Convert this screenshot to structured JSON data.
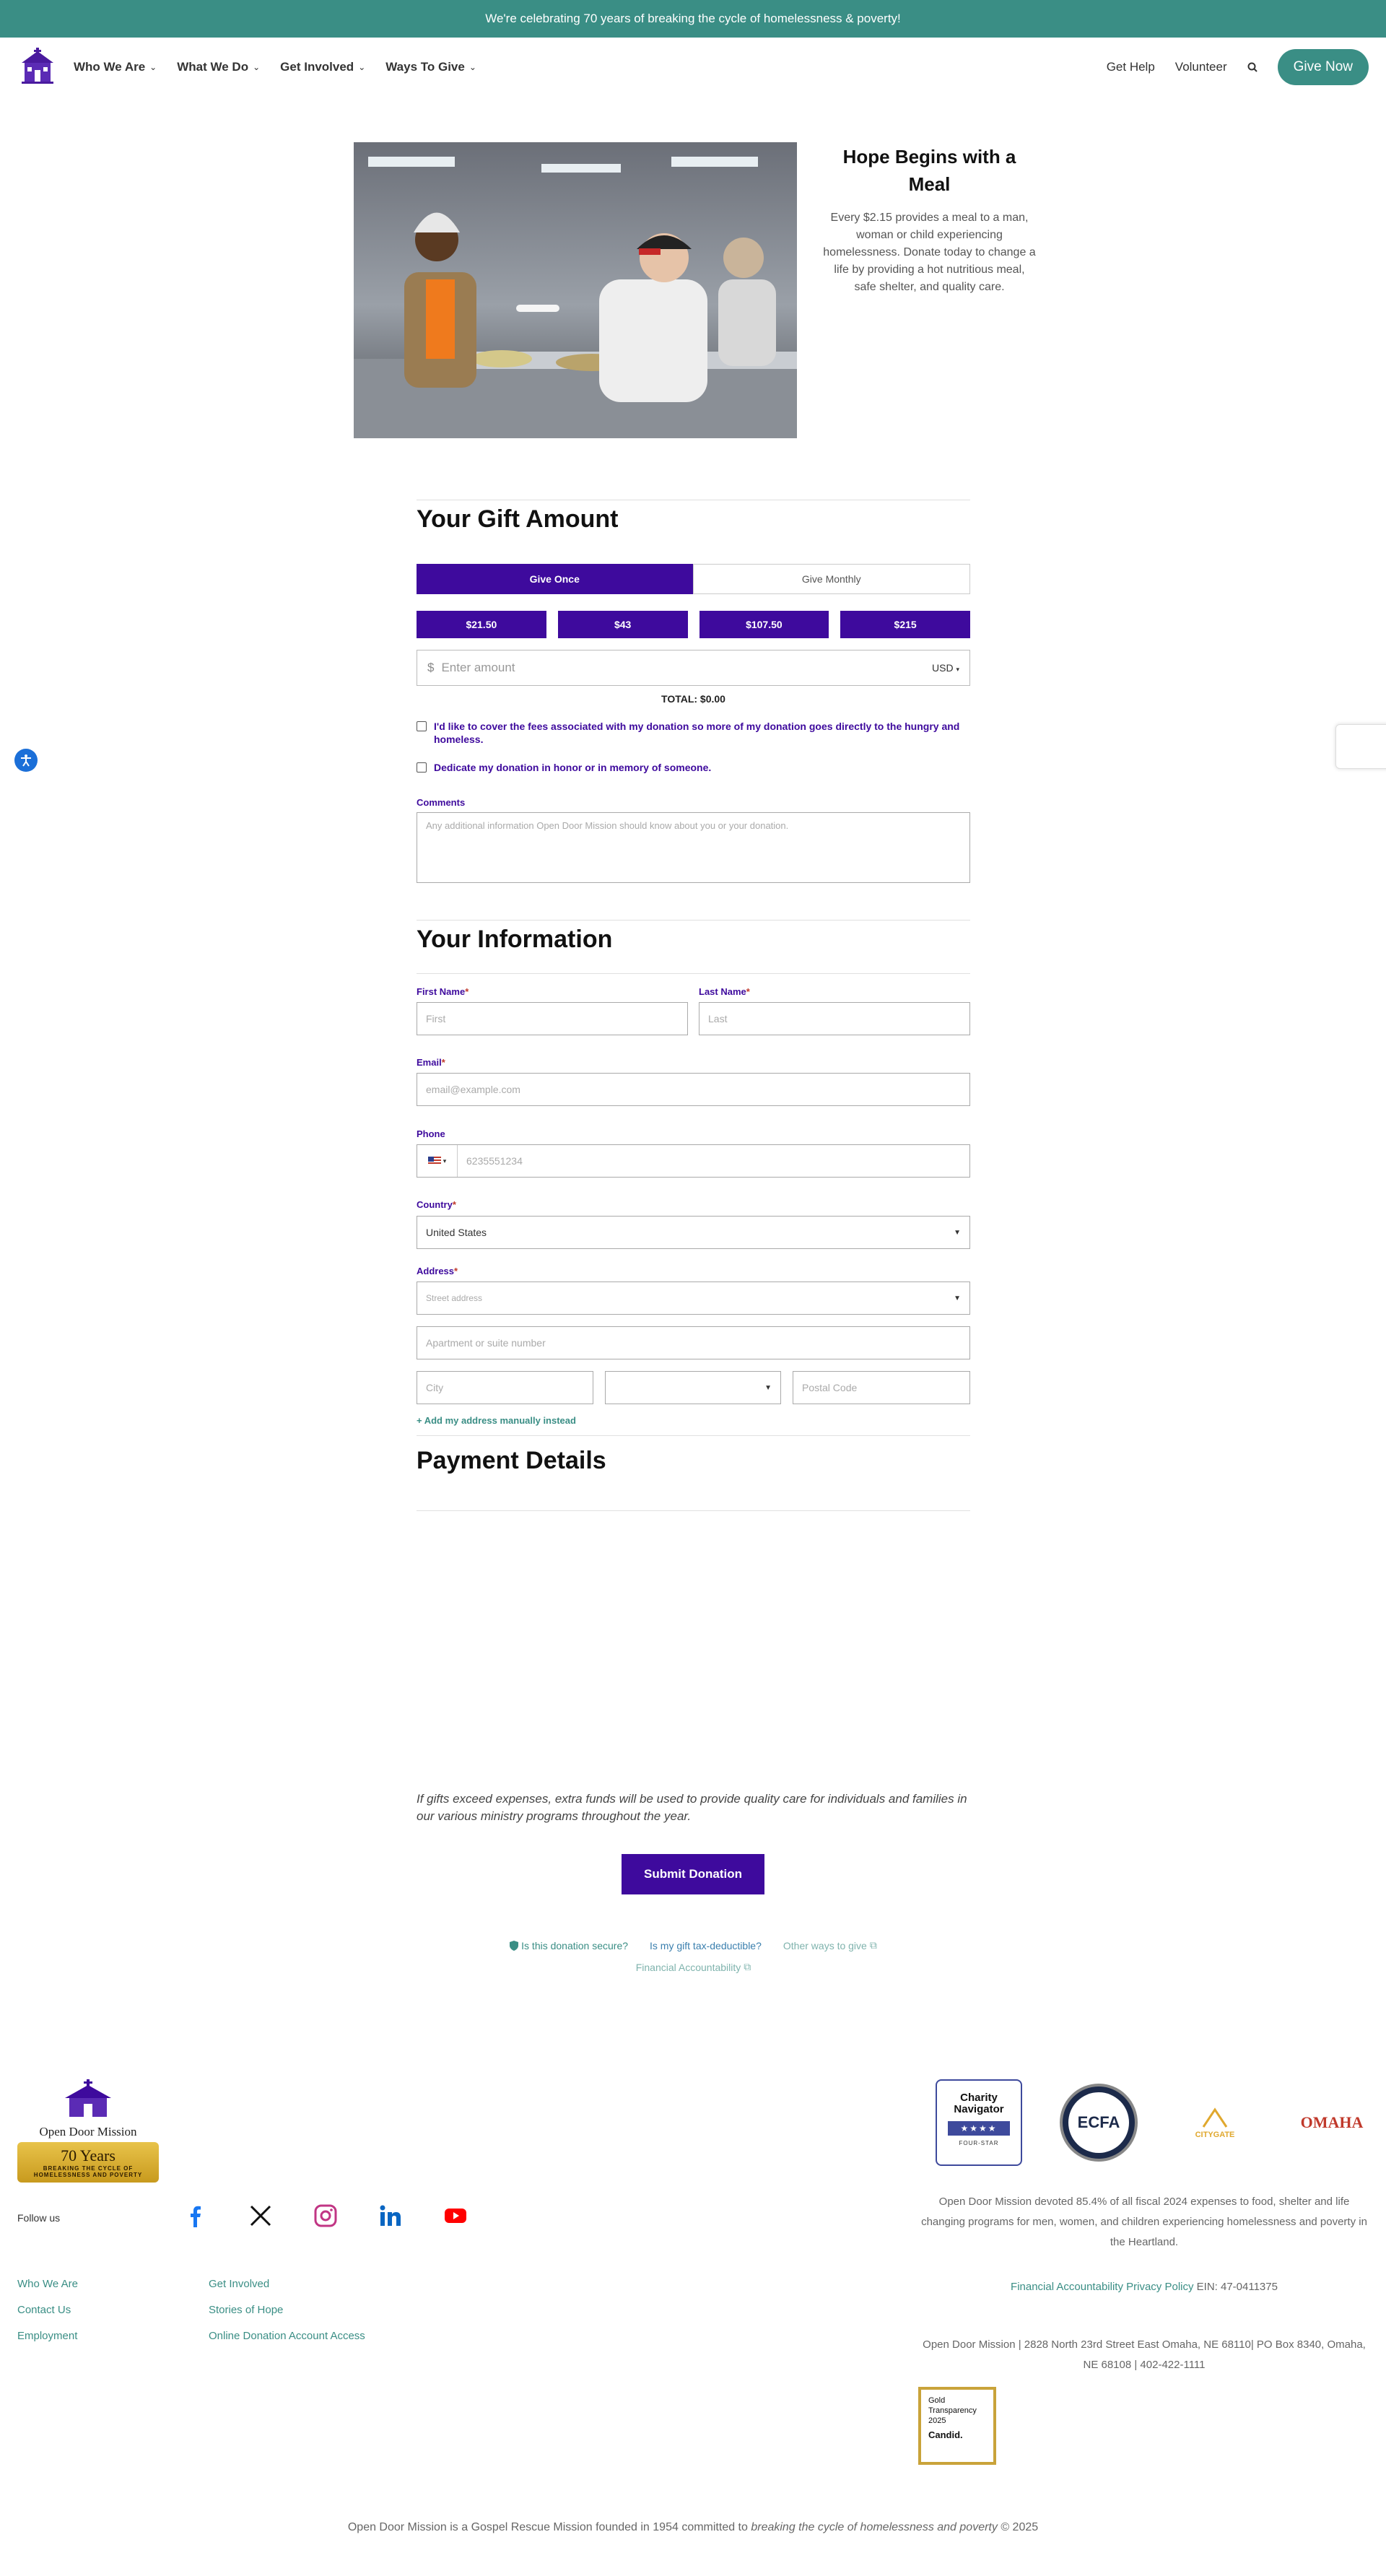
{
  "banner": {
    "text": "We're celebrating 70 years of breaking the cycle of homelessness & poverty!"
  },
  "nav": {
    "items": [
      {
        "label": "Who We Are"
      },
      {
        "label": "What We Do"
      },
      {
        "label": "Get Involved"
      },
      {
        "label": "Ways To Give"
      }
    ],
    "get_help": "Get Help",
    "volunteer": "Volunteer",
    "give_now": "Give Now"
  },
  "hero": {
    "title": "Hope Begins with a Meal",
    "body": "Every $2.15 provides a meal to a man, woman or child experiencing homelessness.  Donate today to change a life by providing a hot nutritious meal, safe shelter, and quality care."
  },
  "gift": {
    "title": "Your Gift Amount",
    "give_once": "Give Once",
    "give_monthly": "Give Monthly",
    "amounts": [
      "$21.50",
      "$43",
      "$107.50",
      "$215"
    ],
    "currency_symbol": "$",
    "amount_placeholder": "Enter amount",
    "currency": "USD",
    "total": "TOTAL: $0.00",
    "cover_fees": "I'd like to cover the fees associated with my donation so more of my donation goes directly to the hungry and homeless.",
    "dedicate": "Dedicate my donation in honor or in memory of someone.",
    "comments_label": "Comments",
    "comments_placeholder": "Any additional information Open Door Mission should know about you or your donation."
  },
  "info": {
    "title": "Your Information",
    "first_name_label": "First Name",
    "first_name_placeholder": "First",
    "last_name_label": "Last Name",
    "last_name_placeholder": "Last",
    "email_label": "Email",
    "email_placeholder": "email@example.com",
    "phone_label": "Phone",
    "phone_placeholder": "6235551234",
    "country_label": "Country",
    "country_value": "United States",
    "address_label": "Address",
    "street_placeholder": "Street address",
    "apartment_placeholder": "Apartment or suite number",
    "city_placeholder": "City",
    "postal_placeholder": "Postal Code",
    "manual_address": "+ Add my address manually instead",
    "required_mark": "*"
  },
  "payment": {
    "title": "Payment Details",
    "disclaimer": "If gifts exceed expenses, extra funds will be used to provide quality care for individuals and families in our various ministry programs throughout the year.",
    "submit": "Submit Donation",
    "secure": "Is this donation secure?",
    "tax": "Is my gift tax-deductible?",
    "other_ways": "Other ways to give",
    "accountability": "Financial Accountability"
  },
  "footer": {
    "logo_name": "Open Door Mission",
    "logo_years": "70 Years",
    "logo_tagline": "BREAKING THE CYCLE OF HOMELESSNESS AND POVERTY",
    "follow_us": "Follow us",
    "col1": [
      "Who We Are",
      "Contact Us",
      "Employment"
    ],
    "col2": [
      "Get Involved",
      "Stories of Hope",
      "Online Donation Account Access"
    ],
    "charity_navigator": "Charity Navigator",
    "four_star": "FOUR-STAR",
    "ecfa": "ECFA",
    "citygate": "CITYGATE",
    "omaha": "OMAHA",
    "stat": "Open Door Mission devoted 85.4% of all fiscal 2024 expenses to food, shelter and life changing programs for men, women, and children experiencing homelessness and poverty in the Heartland.",
    "fin_accountability": "Financial Accountability",
    "privacy": "Privacy Policy",
    "ein": "EIN: 47-0411375",
    "address": "Open Door Mission | 2828 North 23rd Street East Omaha, NE 68110| PO Box 8340, Omaha, NE 68108 | 402-422-1111",
    "candid_line1": "Gold",
    "candid_line2": "Transparency",
    "candid_line3": "2025",
    "candid_brand": "Candid.",
    "bottom_prefix": "Open Door Mission is a Gospel Rescue Mission founded in 1954 committed to ",
    "bottom_italic": "breaking the cycle of homelessness and poverty",
    "bottom_suffix": " © 2025"
  },
  "colors": {
    "teal": "#3a8e85",
    "purple": "#3e0a9d"
  }
}
